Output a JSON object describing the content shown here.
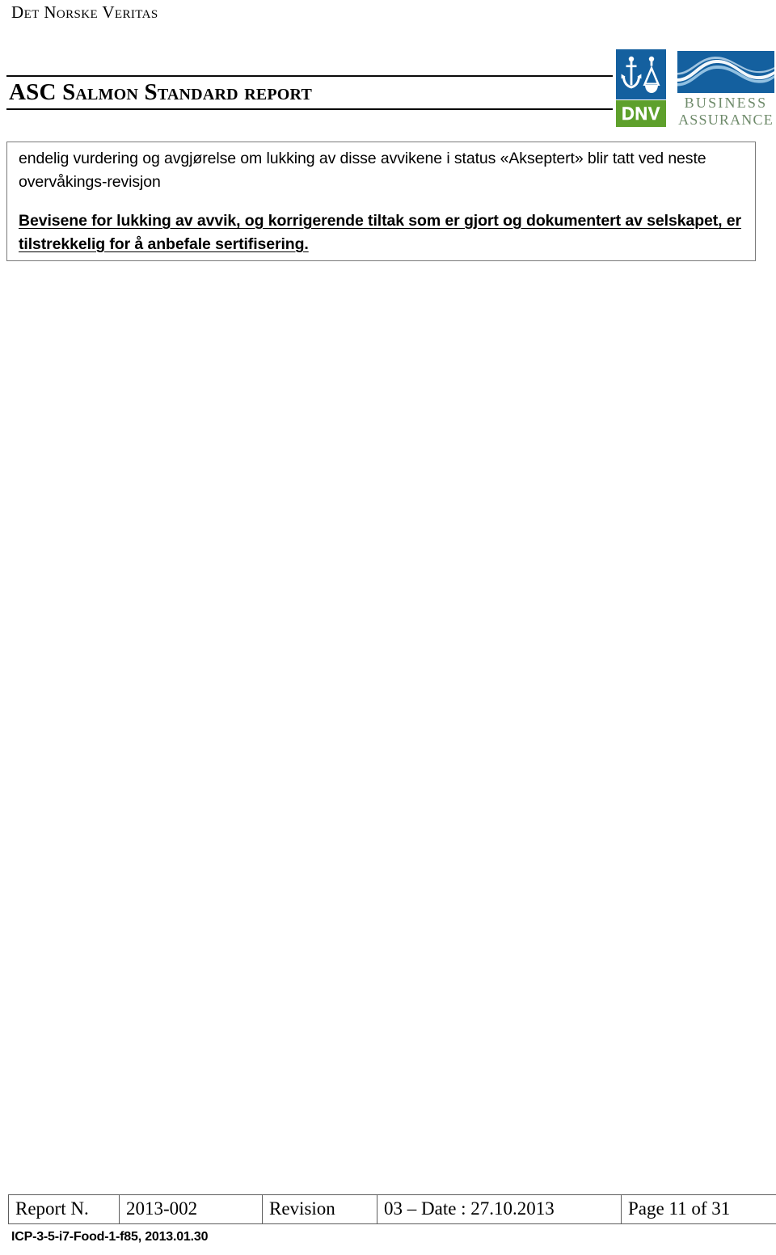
{
  "header": {
    "company_name": "Det Norske Veritas",
    "report_title": "ASC Salmon Standard report"
  },
  "logos": {
    "dnv": {
      "wordmark": "DNV",
      "mark_icon": "dnv-anchor-scales-icon",
      "mark_color": "#14609f",
      "wordmark_bg_color": "#5ea02c"
    },
    "business_assurance": {
      "line1": "BUSINESS",
      "line2": "ASSURANCE",
      "wave_icon": "wave-graphic-icon",
      "wave_bg_color": "#14609f",
      "text_color": "#6e8a6a"
    }
  },
  "content": {
    "paragraph": "endelig vurdering og avgjørelse om lukking av disse avvikene i status «Akseptert» blir tatt ved neste overvåkings-revisjon",
    "conclusion": "Bevisene for lukking av avvik, og korrigerende tiltak som er gjort og dokumentert av selskapet, er tilstrekkelig for å anbefale sertifisering."
  },
  "footer": {
    "table": {
      "cells": [
        "Report N.",
        "2013-002",
        "Revision",
        "03 – Date : 27.10.2013",
        "Page 11 of 31"
      ]
    },
    "reference": "ICP-3-5-i7-Food-1-f85, 2013.01.30"
  }
}
